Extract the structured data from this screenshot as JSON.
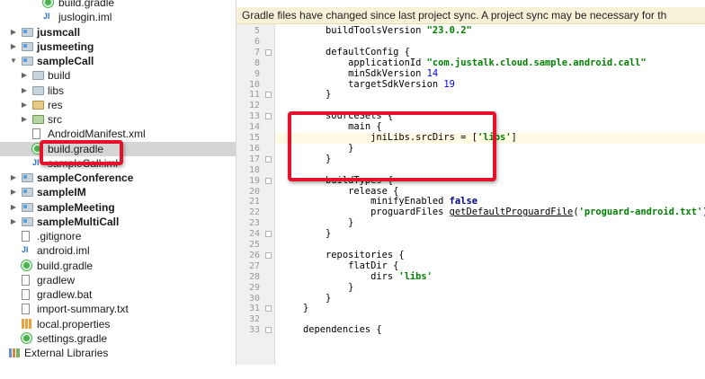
{
  "notice": {
    "text": "Gradle files have changed since last project sync. A project sync may be necessary for th"
  },
  "tree": {
    "items": [
      {
        "label": "build.gradle",
        "icon": "gradle-icon",
        "bold": false,
        "arrow": ""
      },
      {
        "label": "juslogin.iml",
        "icon": "iml-icon",
        "bold": false,
        "arrow": ""
      },
      {
        "label": "jusmcall",
        "icon": "module-folder-icon",
        "bold": true,
        "arrow": "▶"
      },
      {
        "label": "jusmeeting",
        "icon": "module-folder-icon",
        "bold": true,
        "arrow": "▶"
      },
      {
        "label": "sampleCall",
        "icon": "module-folder-icon",
        "bold": true,
        "arrow": "▼"
      },
      {
        "label": "build",
        "icon": "folder-icon",
        "bold": false,
        "arrow": "▶"
      },
      {
        "label": "libs",
        "icon": "folder-icon",
        "bold": false,
        "arrow": "▶"
      },
      {
        "label": "res",
        "icon": "res-folder-icon",
        "bold": false,
        "arrow": "▶"
      },
      {
        "label": "src",
        "icon": "src-folder-icon",
        "bold": false,
        "arrow": "▶"
      },
      {
        "label": "AndroidManifest.xml",
        "icon": "file-icon",
        "bold": false,
        "arrow": ""
      },
      {
        "label": "build.gradle",
        "icon": "gradle-icon",
        "bold": false,
        "arrow": "",
        "selected": true
      },
      {
        "label": "sampleCall.iml",
        "icon": "iml-icon",
        "bold": false,
        "arrow": ""
      },
      {
        "label": "sampleConference",
        "icon": "module-folder-icon",
        "bold": true,
        "arrow": "▶"
      },
      {
        "label": "sampleIM",
        "icon": "module-folder-icon",
        "bold": true,
        "arrow": "▶"
      },
      {
        "label": "sampleMeeting",
        "icon": "module-folder-icon",
        "bold": true,
        "arrow": "▶"
      },
      {
        "label": "sampleMultiCall",
        "icon": "module-folder-icon",
        "bold": true,
        "arrow": "▶"
      },
      {
        "label": ".gitignore",
        "icon": "file-icon",
        "bold": false,
        "arrow": ""
      },
      {
        "label": "android.iml",
        "icon": "iml-icon",
        "bold": false,
        "arrow": ""
      },
      {
        "label": "build.gradle",
        "icon": "gradle-icon",
        "bold": false,
        "arrow": ""
      },
      {
        "label": "gradlew",
        "icon": "file-icon",
        "bold": false,
        "arrow": ""
      },
      {
        "label": "gradlew.bat",
        "icon": "file-icon",
        "bold": false,
        "arrow": ""
      },
      {
        "label": "import-summary.txt",
        "icon": "file-icon",
        "bold": false,
        "arrow": ""
      },
      {
        "label": "local.properties",
        "icon": "properties-icon",
        "bold": false,
        "arrow": ""
      },
      {
        "label": "settings.gradle",
        "icon": "gradle-icon",
        "bold": false,
        "arrow": ""
      },
      {
        "label": "External Libraries",
        "icon": "libraries-icon",
        "bold": false,
        "arrow": ""
      }
    ]
  },
  "editor": {
    "line_numbers": [
      "5",
      "6",
      "7",
      "8",
      "9",
      "10",
      "11",
      "12",
      "13",
      "14",
      "15",
      "16",
      "17",
      "18",
      "19",
      "20",
      "21",
      "22",
      "23",
      "24",
      "25",
      "26",
      "27",
      "28",
      "29",
      "30",
      "31",
      "32",
      "33"
    ],
    "lines": [
      [
        [
          "t",
          "        buildToolsVersion "
        ],
        [
          "str",
          "\"23.0.2\""
        ]
      ],
      [
        [
          "t",
          ""
        ]
      ],
      [
        [
          "t",
          "        defaultConfig {"
        ]
      ],
      [
        [
          "t",
          "            applicationId "
        ],
        [
          "str",
          "\"com.justalk.cloud.sample.android.call\""
        ]
      ],
      [
        [
          "t",
          "            minSdkVersion "
        ],
        [
          "num",
          "14"
        ]
      ],
      [
        [
          "t",
          "            targetSdkVersion "
        ],
        [
          "num",
          "19"
        ]
      ],
      [
        [
          "t",
          "        }"
        ]
      ],
      [
        [
          "t",
          ""
        ]
      ],
      [
        [
          "t",
          "        sourceSets {"
        ]
      ],
      [
        [
          "t",
          "            main {"
        ]
      ],
      [
        [
          "t",
          "                jniLibs.srcDirs = ["
        ],
        [
          "str",
          "'libs'"
        ],
        [
          "t",
          "]"
        ]
      ],
      [
        [
          "t",
          "            }"
        ]
      ],
      [
        [
          "t",
          "        }"
        ]
      ],
      [
        [
          "t",
          ""
        ]
      ],
      [
        [
          "t",
          "        buildTypes {"
        ]
      ],
      [
        [
          "t",
          "            release {"
        ]
      ],
      [
        [
          "t",
          "                minifyEnabled "
        ],
        [
          "kw",
          "false"
        ]
      ],
      [
        [
          "t",
          "                proguardFiles "
        ],
        [
          "u",
          "getDefaultProguardFile"
        ],
        [
          "t",
          "("
        ],
        [
          "str",
          "'proguard-android.txt'"
        ],
        [
          "t",
          "),"
        ]
      ],
      [
        [
          "t",
          "            }"
        ]
      ],
      [
        [
          "t",
          "        }"
        ]
      ],
      [
        [
          "t",
          ""
        ]
      ],
      [
        [
          "t",
          "        repositories {"
        ]
      ],
      [
        [
          "t",
          "            flatDir {"
        ]
      ],
      [
        [
          "t",
          "                dirs "
        ],
        [
          "str",
          "'libs'"
        ]
      ],
      [
        [
          "t",
          "            }"
        ]
      ],
      [
        [
          "t",
          "        }"
        ]
      ],
      [
        [
          "t",
          "    }"
        ]
      ],
      [
        [
          "t",
          ""
        ]
      ],
      [
        [
          "t",
          "    dependencies {"
        ]
      ]
    ]
  },
  "colors": {
    "highlight_red": "#e3132b",
    "notice_bg": "#f7f1d7",
    "selection": "#d5d5d5"
  }
}
